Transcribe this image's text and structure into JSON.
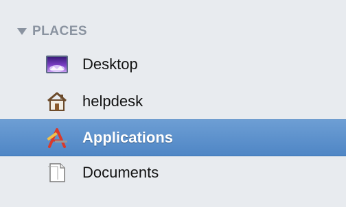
{
  "sidebar": {
    "section_title": "PLACES",
    "items": [
      {
        "label": "Desktop",
        "icon": "desktop-icon",
        "selected": false
      },
      {
        "label": "helpdesk",
        "icon": "home-icon",
        "selected": false
      },
      {
        "label": "Applications",
        "icon": "applications-icon",
        "selected": true
      },
      {
        "label": "Documents",
        "icon": "documents-icon",
        "selected": false
      }
    ]
  },
  "colors": {
    "background": "#e8ebef",
    "selection": "#5a8fc9",
    "section_title": "#8a93a0"
  }
}
